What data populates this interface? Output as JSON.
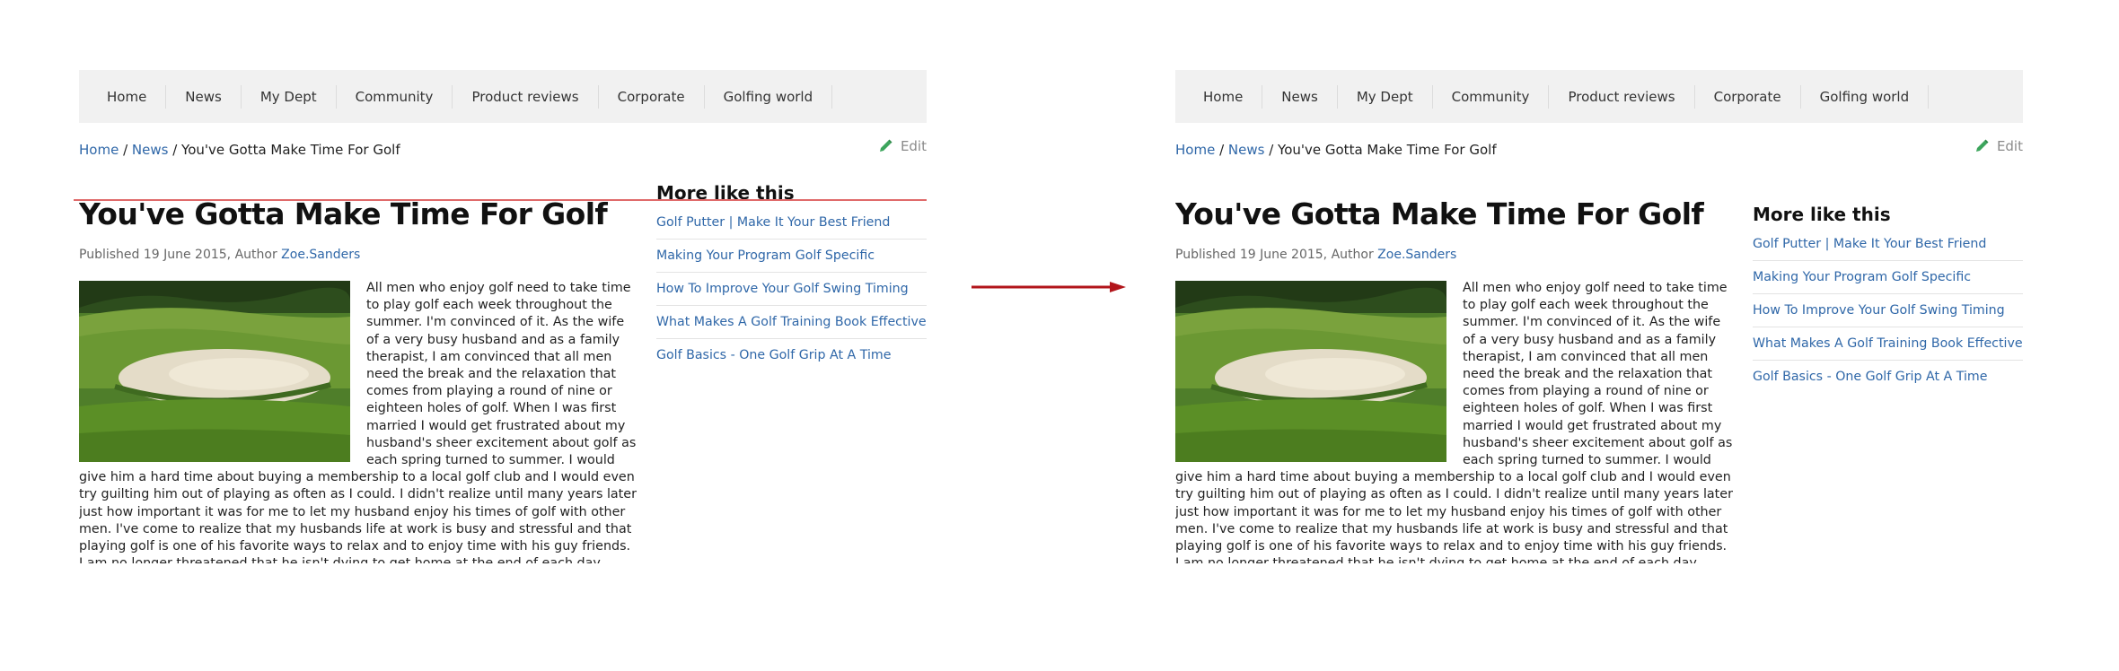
{
  "nav": [
    "Home",
    "News",
    "My Dept",
    "Community",
    "Product reviews",
    "Corporate",
    "Golfing world"
  ],
  "breadcrumb": {
    "home": "Home",
    "sep1": " / ",
    "news": "News",
    "sep2": " / ",
    "current": "You've Gotta Make Time For Golf"
  },
  "edit_label": "Edit",
  "article": {
    "title": "You've Gotta Make Time For Golf",
    "meta_prefix": "Published 19 June 2015, Author ",
    "author": "Zoe.Sanders",
    "body": "All men who enjoy golf need to take time to play golf each week throughout the summer. I'm convinced of it. As the wife of a very busy husband and as a family therapist, I am convinced that all men need the break and the relaxation that comes from playing a round of nine or eighteen holes of golf. When I was first married I would get frustrated about my husband's sheer excitement about golf as each spring turned to summer. I would give him a hard time about buying a membership to a local golf club and I would even try guilting him out of playing as often as I could. I didn't realize until many years later just how important it was for me to let my husband enjoy his times of golf with other men. I've come to realize that my husbands life at work is busy and stressful and that playing golf is one of his favorite ways to relax and to enjoy time with his guy friends. I am no longer threatened that he isn't dying to get home at the end of each day. Instead, I see that golf is not the enemy of our family but actually a"
  },
  "sidebar": {
    "title": "More like this",
    "items": [
      "Golf Putter | Make It Your Best Friend",
      "Making Your Program Golf Specific",
      "How To Improve Your Golf Swing Timing",
      "What Makes A Golf Training Book Effective",
      "Golf Basics - One Golf Grip At A Time"
    ]
  },
  "colors": {
    "link": "#2f67a8",
    "navbar_bg": "#f1f1f1",
    "arrow": "#b2151b",
    "guide_line": "#e06a6a",
    "edit_icon": "#3ca55c"
  }
}
